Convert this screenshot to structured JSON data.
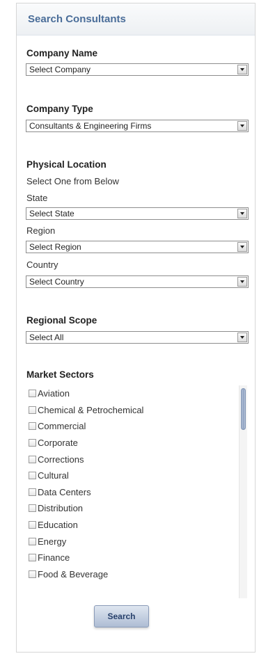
{
  "panel": {
    "title": "Search Consultants"
  },
  "company_name": {
    "heading": "Company Name",
    "selected": "Select Company"
  },
  "company_type": {
    "heading": "Company Type",
    "selected": "Consultants & Engineering Firms"
  },
  "physical_location": {
    "heading": "Physical Location",
    "instruction": "Select One from Below",
    "state_label": "State",
    "state_selected": "Select State",
    "region_label": "Region",
    "region_selected": "Select Region",
    "country_label": "Country",
    "country_selected": "Select Country"
  },
  "regional_scope": {
    "heading": "Regional Scope",
    "selected": "Select All"
  },
  "market_sectors": {
    "heading": "Market Sectors",
    "items": [
      "Aviation",
      "Chemical & Petrochemical",
      "Commercial",
      "Corporate",
      "Corrections",
      "Cultural",
      "Data Centers",
      "Distribution",
      "Education",
      "Energy",
      "Finance",
      "Food & Beverage"
    ]
  },
  "search_button": {
    "label": "Search"
  }
}
